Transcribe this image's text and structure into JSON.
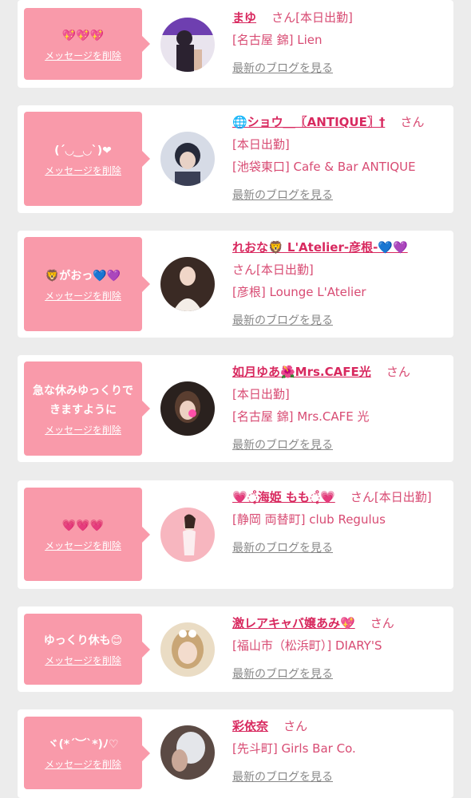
{
  "colors": {
    "bubble": "#f99aaa",
    "name": "#d8295f",
    "text_pink": "#d84b73",
    "blog_link": "#888888",
    "background": "#ececec"
  },
  "delete_label": "メッセージを削除",
  "blog_label": "最新のブログを見る",
  "honorific": "さん",
  "entries": [
    {
      "message": "💖💖💖",
      "name": "まゆ",
      "status": "[本日出勤]",
      "shop": "[名古屋 錦] Lien"
    },
    {
      "message": "(´◡‿◡`)❤",
      "name": "🌐ショウ＿〖ANTIQUE〗†",
      "status": "[本日出勤]",
      "shop": "[池袋東口] Cafe & Bar ANTIQUE"
    },
    {
      "message": "🦁がおっ💙💜",
      "name": "れおな🦁 L'Atelier-彦根-💙💜",
      "status": "[本日出勤]",
      "shop": "[彦根] Lounge L'Atelier"
    },
    {
      "message": "急な休みゆっくりできますように",
      "name": "如月ゆあ🌺Mrs.CAFE光",
      "status": "[本日出勤]",
      "shop": "[名古屋 錦] Mrs.CAFE 光"
    },
    {
      "message": "💗💗💗",
      "name": "💗◌̥̊海姫 もも◌̥̊💗",
      "status": "[本日出勤]",
      "shop": "[静岡 両替町] club Regulus"
    },
    {
      "message": "ゆっくり休も😊",
      "name": "激レアキャバ嬢あみ💖",
      "status": "",
      "shop": "[福山市（松浜町）] DIARY'S"
    },
    {
      "message": "ヾ(*´︶`*)ﾉ♡",
      "name": "彩依奈",
      "status": "",
      "shop": "[先斗町] Girls Bar Co."
    }
  ]
}
